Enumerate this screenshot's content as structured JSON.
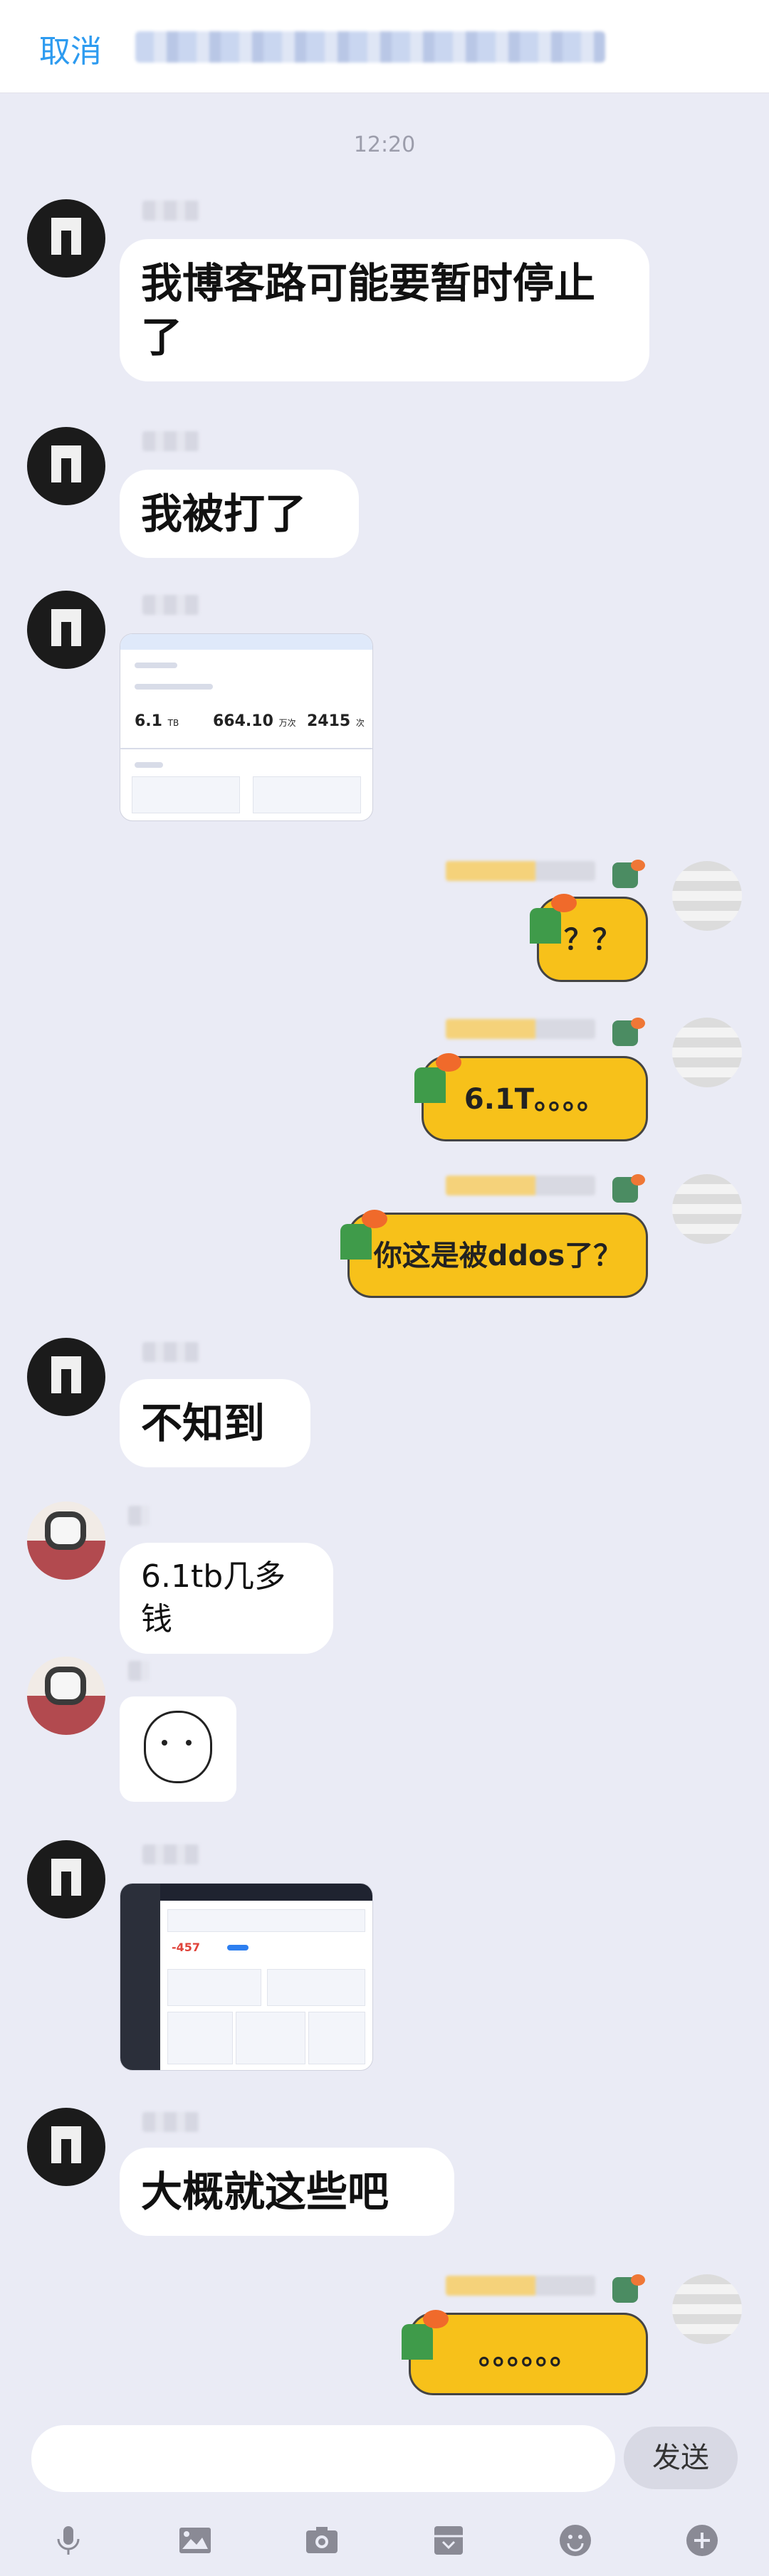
{
  "header": {
    "cancel_label": "取消"
  },
  "chat": {
    "timestamp": "12:20",
    "messages": [
      {
        "side": "left",
        "text": "我博客路可能要暂时停止了"
      },
      {
        "side": "left",
        "text": "我被打了"
      },
      {
        "side": "left",
        "type": "image",
        "image_text": {
          "big1": "6.1",
          "big1_unit": "TB",
          "big2": "664.10",
          "big2_unit": "万次",
          "big3": "2415",
          "big3_unit": "次"
        }
      },
      {
        "side": "right",
        "text": "？？"
      },
      {
        "side": "right",
        "text": "6.1T。。。。"
      },
      {
        "side": "right",
        "text": "你这是被ddos了？"
      },
      {
        "side": "left",
        "text": "不知到"
      },
      {
        "side": "left",
        "text": "6.1tb几多钱"
      },
      {
        "side": "left",
        "type": "sticker"
      },
      {
        "side": "left",
        "type": "image",
        "image_text": {
          "value": "-457"
        }
      },
      {
        "side": "left",
        "text": "大概就这些吧"
      },
      {
        "side": "right",
        "text": "。。。。。。"
      }
    ]
  },
  "footer": {
    "input_placeholder": "",
    "send_label": "发送",
    "toolbar_icons": [
      "microphone-icon",
      "image-icon",
      "camera-icon",
      "favorite-icon",
      "emoji-icon",
      "plus-icon"
    ]
  }
}
